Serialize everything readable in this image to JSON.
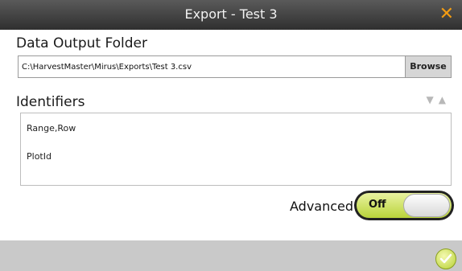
{
  "window": {
    "title": "Export - Test 3",
    "close_icon": "close-x-icon",
    "accent_color": "#f39c12"
  },
  "output": {
    "label": "Data Output Folder",
    "path_value": "C:\\HarvestMaster\\Mirus\\Exports\\Test 3.csv",
    "browse_label": "Browse"
  },
  "identifiers": {
    "label": "Identifiers",
    "sort_icons": [
      "triangle-down-icon",
      "triangle-up-icon"
    ],
    "items": [
      "Range,Row",
      "PlotId"
    ]
  },
  "advanced": {
    "label": "Advanced",
    "toggle_state": "Off"
  },
  "footer": {
    "confirm_icon": "checkmark-circle-icon"
  }
}
